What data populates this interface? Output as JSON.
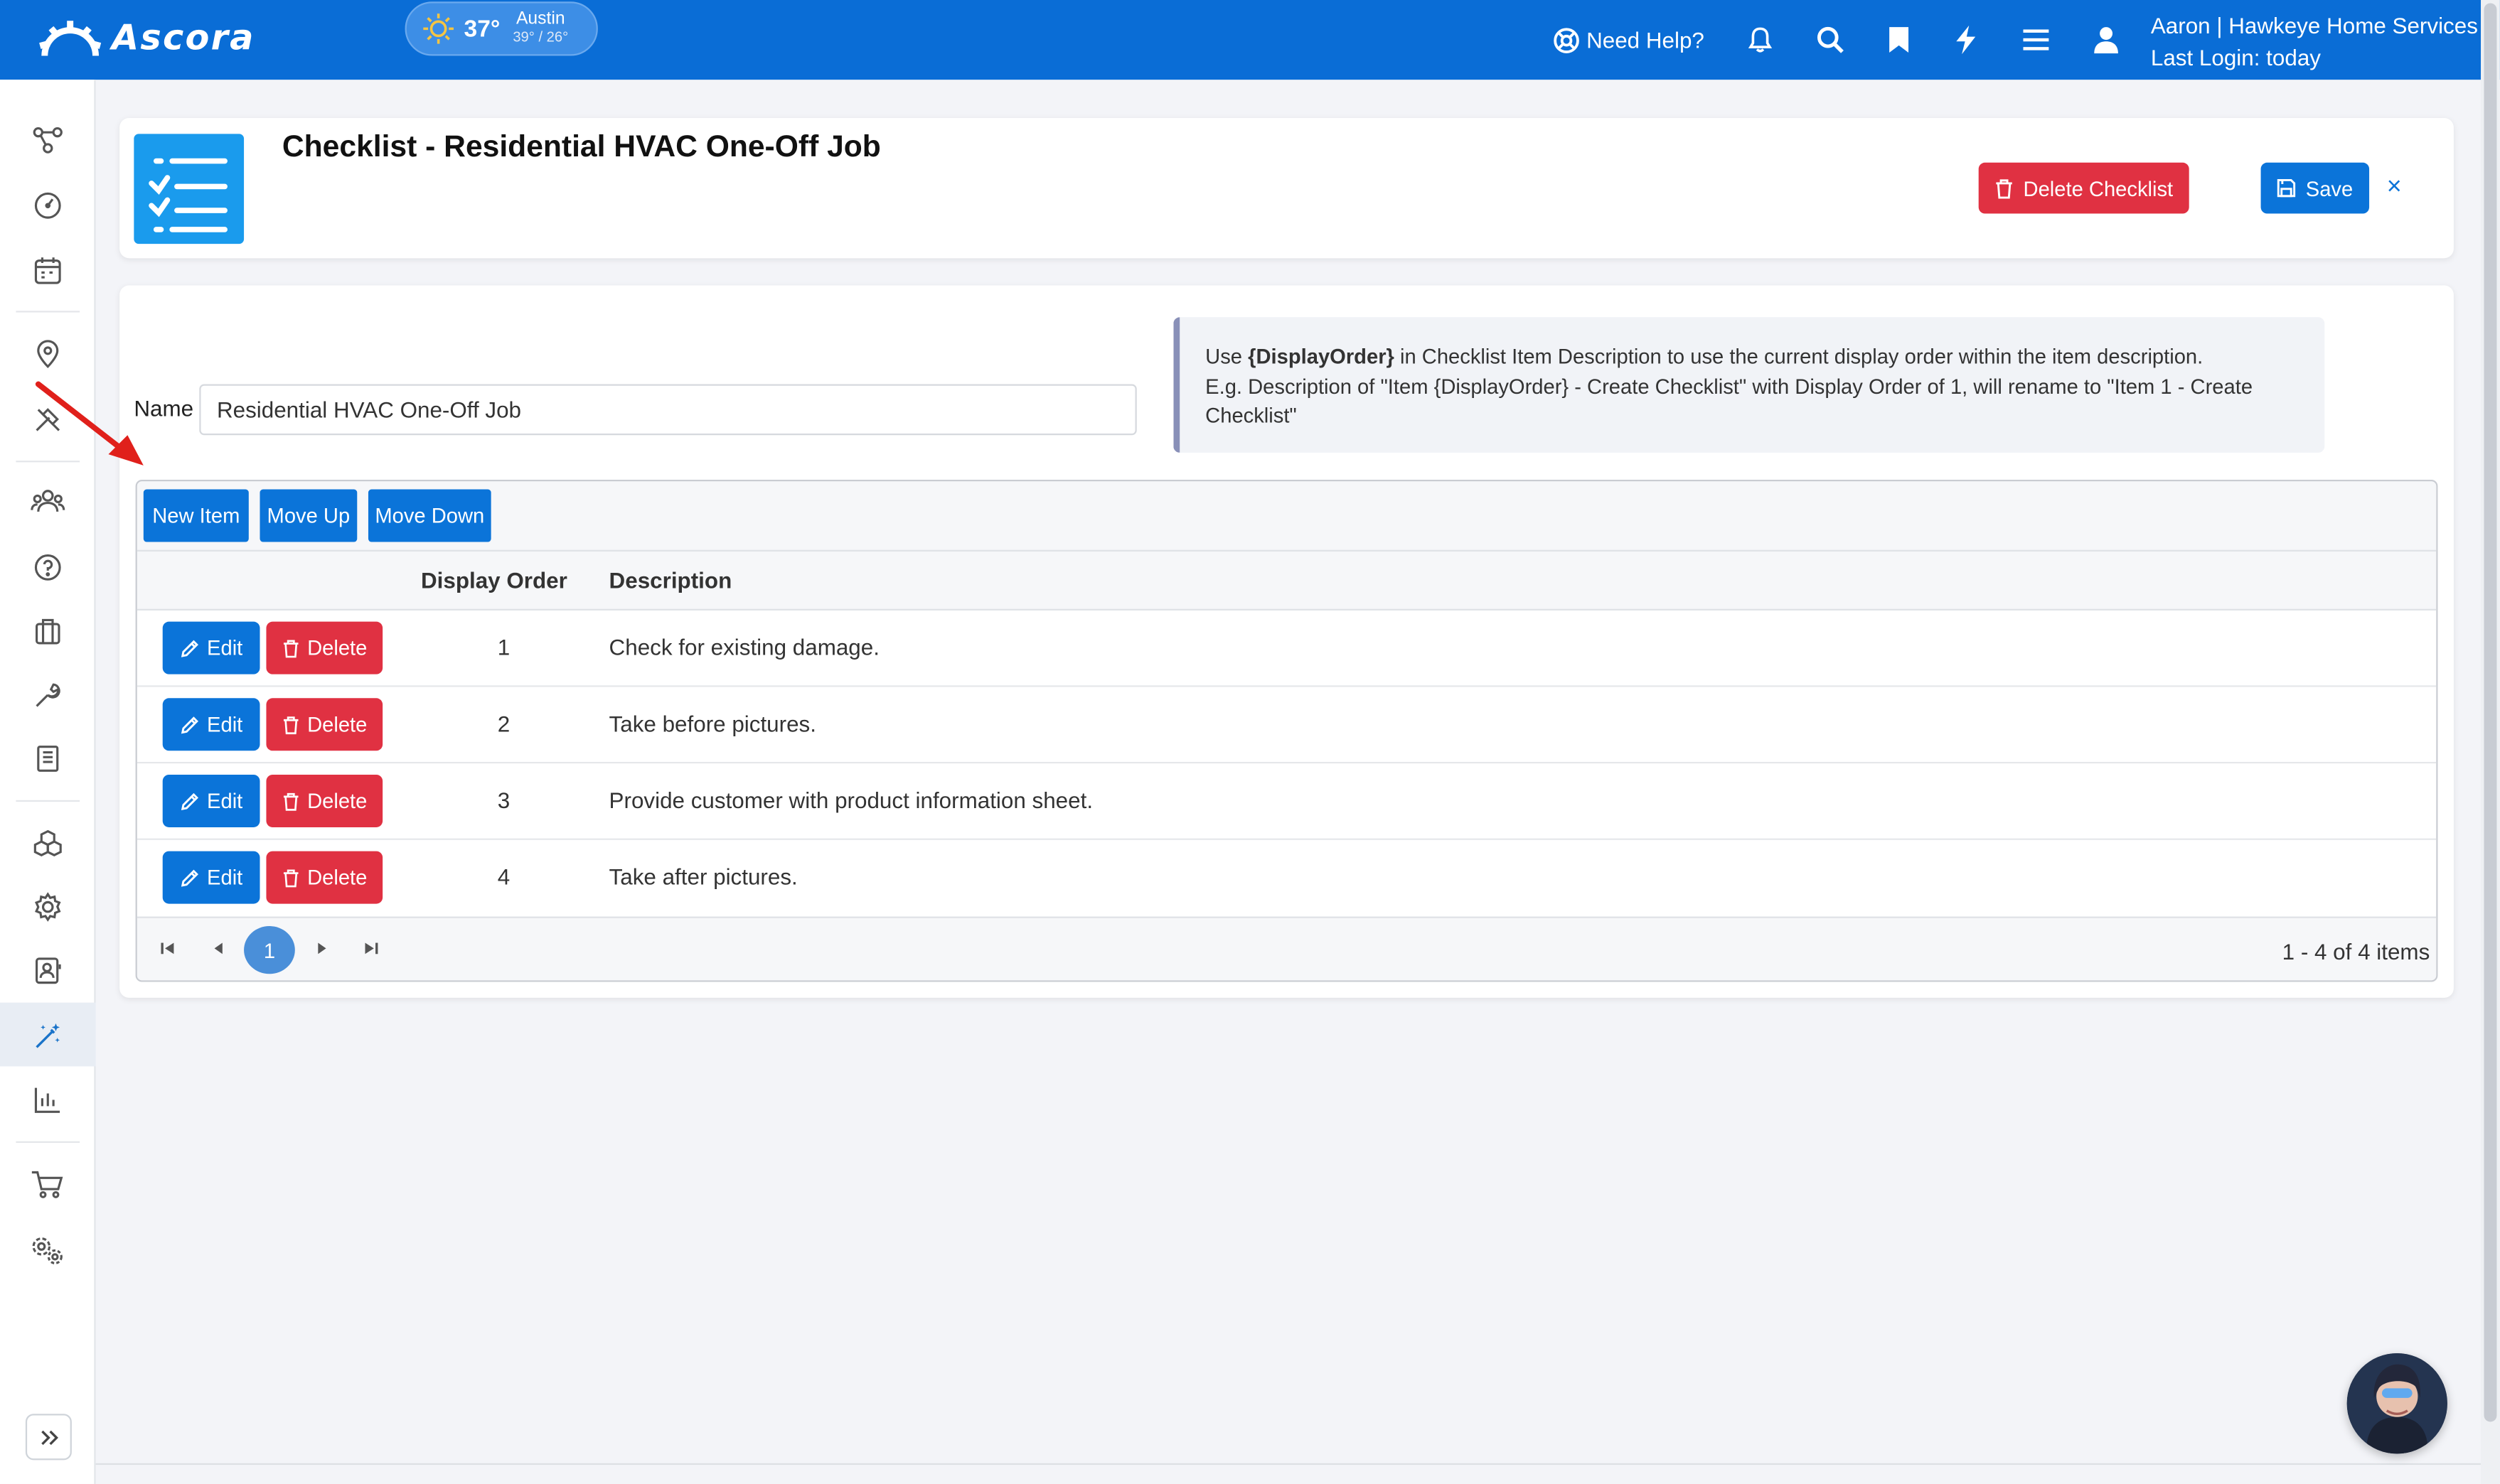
{
  "topbar": {
    "brand": "Ascora",
    "weather": {
      "temp": "37°",
      "city": "Austin",
      "range": "39° / 26°"
    },
    "help_label": "Need Help?",
    "user_line1": "Aaron | Hawkeye Home Services",
    "user_line2": "Last Login: today"
  },
  "header": {
    "title": "Checklist - Residential HVAC One-Off Job",
    "delete_label": "Delete Checklist",
    "save_label": "Save",
    "close_label": "×"
  },
  "form": {
    "name_label": "Name",
    "name_value": "Residential HVAC One-Off Job"
  },
  "info": {
    "line1_pre": "Use ",
    "line1_token": "{DisplayOrder}",
    "line1_post": " in Checklist Item Description to use the current display order within the item description.",
    "line2": "E.g. Description of \"Item {DisplayOrder} - Create Checklist\" with Display Order of 1, will rename to \"Item 1 - Create Checklist\""
  },
  "grid": {
    "toolbar": {
      "new_item": "New Item",
      "move_up": "Move Up",
      "move_down": "Move Down"
    },
    "columns": {
      "order": "Display Order",
      "description": "Description"
    },
    "edit_label": "Edit",
    "delete_label": "Delete",
    "rows": [
      {
        "order": "1",
        "description": "Check for existing damage."
      },
      {
        "order": "2",
        "description": "Take before pictures."
      },
      {
        "order": "3",
        "description": "Provide customer with product information sheet."
      },
      {
        "order": "4",
        "description": "Take after pictures."
      }
    ],
    "pager": {
      "current_page": "1",
      "info": "1 - 4 of 4 items"
    }
  },
  "colors": {
    "topbar": "#0a6dd6",
    "primary": "#0b74d9",
    "danger": "#e03142",
    "annotation_arrow": "#e0201b"
  },
  "icons": [
    "gear-logo-icon",
    "sun-icon",
    "lifebuoy-icon",
    "bell-icon",
    "search-icon",
    "bookmark-icon",
    "bolt-icon",
    "menu-icon",
    "user-icon",
    "checklist-icon",
    "trash-icon",
    "save-icon",
    "pencil-icon",
    "expand-icon"
  ]
}
